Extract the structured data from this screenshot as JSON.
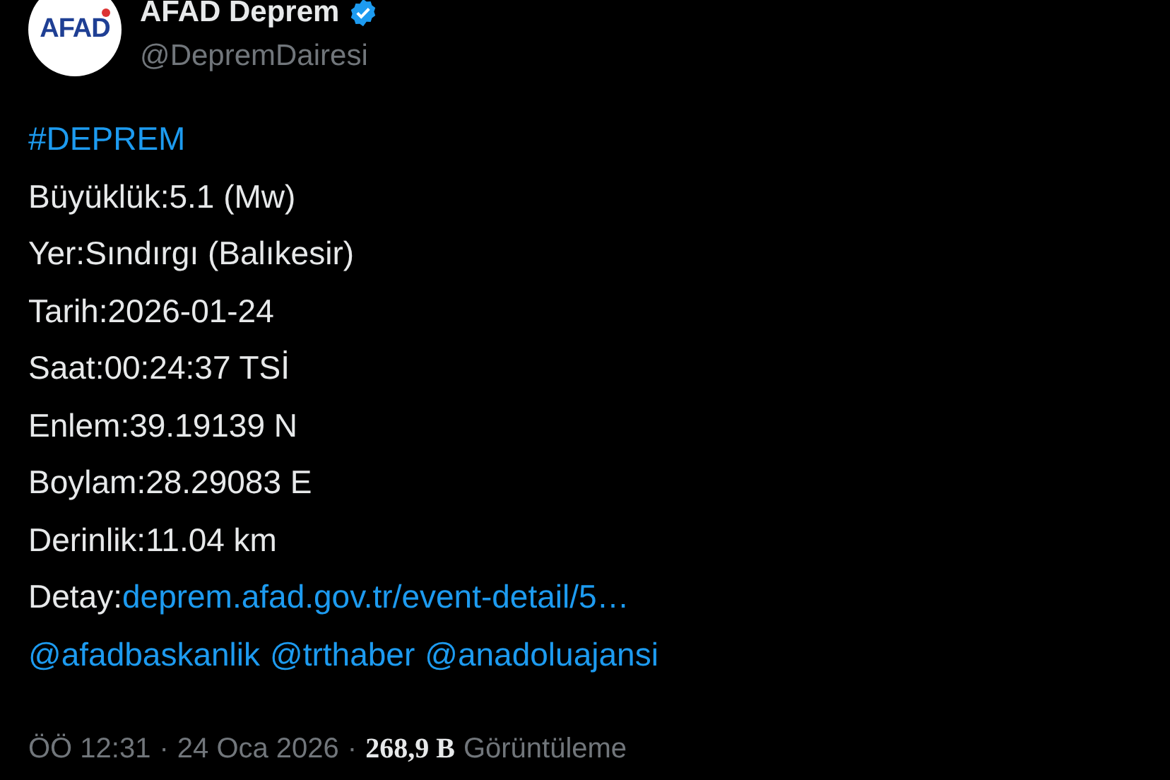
{
  "author": {
    "avatar_text": "AFAD",
    "name": "AFAD Deprem",
    "verified": true,
    "handle": "@DepremDairesi"
  },
  "lines": [
    [
      {
        "text": "#DEPREM",
        "link": true
      }
    ],
    [
      {
        "text": "Büyüklük:5.1 (Mw)",
        "link": false
      }
    ],
    [
      {
        "text": "Yer:Sındırgı (Balıkesir)",
        "link": false
      }
    ],
    [
      {
        "text": "Tarih:2026-01-24",
        "link": false
      }
    ],
    [
      {
        "text": "Saat:00:24:37 TSİ",
        "link": false
      }
    ],
    [
      {
        "text": "Enlem:39.19139 N",
        "link": false
      }
    ],
    [
      {
        "text": "Boylam:28.29083 E",
        "link": false
      }
    ],
    [
      {
        "text": "Derinlik:11.04 km",
        "link": false
      }
    ],
    [
      {
        "text": "Detay:",
        "link": false
      },
      {
        "text": "deprem.afad.gov.tr/event-detail/5…",
        "link": true
      }
    ],
    [
      {
        "text": "@afadbaskanlik",
        "link": true
      },
      {
        "text": "@trthaber",
        "link": true
      },
      {
        "text": "@anadoluajansi",
        "link": true
      }
    ]
  ],
  "meta": [
    {
      "kind": "time",
      "text": "ÖÖ 12:31"
    },
    {
      "kind": "sep",
      "text": "·"
    },
    {
      "kind": "date",
      "text": "24 Oca 2026"
    },
    {
      "kind": "sep",
      "text": "·"
    },
    {
      "kind": "count",
      "text": "268,9 B"
    },
    {
      "kind": "label",
      "text": "Görüntüleme"
    }
  ]
}
